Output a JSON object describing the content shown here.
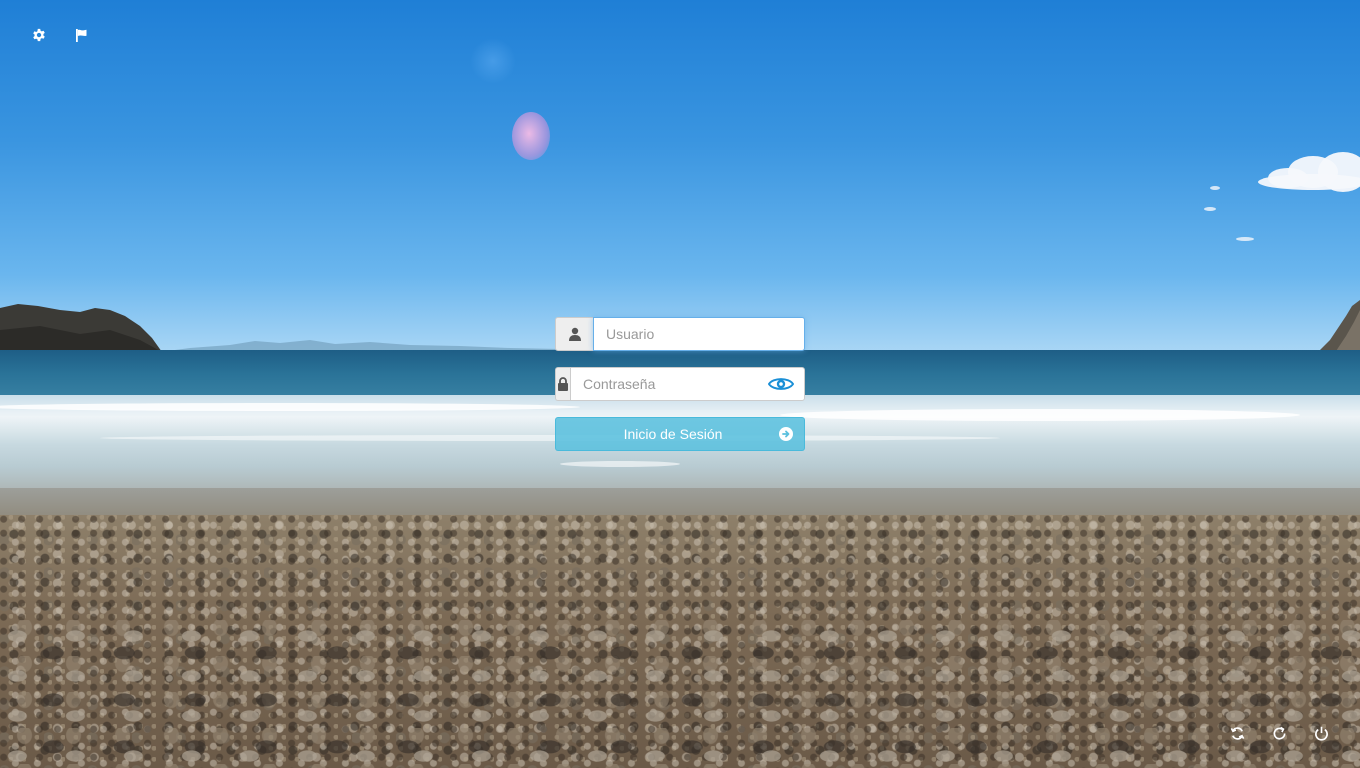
{
  "toolbar_top": {
    "settings_icon": "gear-icon",
    "language_icon": "flag-icon"
  },
  "login": {
    "username": {
      "placeholder": "Usuario",
      "value": "",
      "icon": "user-icon"
    },
    "password": {
      "placeholder": "Contraseña",
      "value": "",
      "icon": "lock-icon",
      "toggle_icon": "eye-icon"
    },
    "submit": {
      "label": "Inicio de Sesión",
      "icon": "arrow-circle-right-icon"
    }
  },
  "toolbar_bottom": {
    "icons": [
      "refresh-icon",
      "restart-icon",
      "power-icon"
    ]
  },
  "colors": {
    "button": "#5bc0de",
    "eye": "#1a8fd6",
    "focus": "#66afe9"
  }
}
